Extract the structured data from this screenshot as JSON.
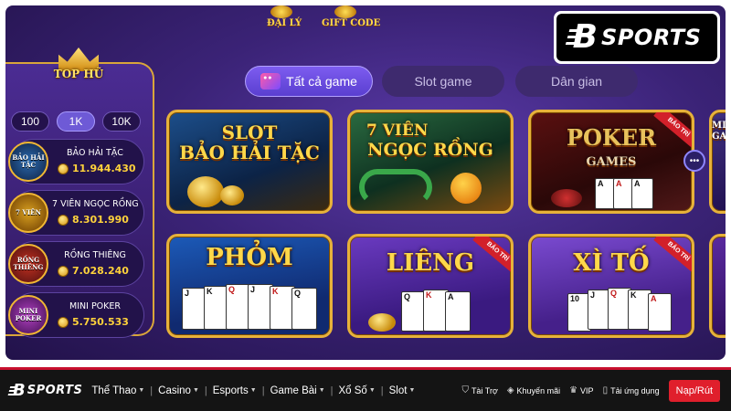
{
  "top_deco": {
    "agent_label": "ĐẠI LÝ",
    "giftcode_label": "GIFT CODE"
  },
  "brand": {
    "b": "B",
    "name": "SPORTS"
  },
  "tophu": {
    "title": "TOP HŨ",
    "tabs": [
      "100",
      "1K",
      "10K"
    ],
    "active_tab": "1K",
    "jackpots": [
      {
        "icon_text": "BẢO HẢI TẶC",
        "name": "BẢO HẢI TẶC",
        "amount": "11.944.430"
      },
      {
        "icon_text": "7 VIÊN",
        "name": "7 VIÊN NGỌC RỒNG",
        "amount": "8.301.990"
      },
      {
        "icon_text": "RỒNG THIÊNG",
        "name": "RỒNG THIÊNG",
        "amount": "7.028.240"
      },
      {
        "icon_text": "MINI POKER",
        "name": "MINI POKER",
        "amount": "5.750.533"
      }
    ]
  },
  "categories": [
    {
      "label": "Tất cả game",
      "active": true
    },
    {
      "label": "Slot game",
      "active": false
    },
    {
      "label": "Dân gian",
      "active": false
    }
  ],
  "games": {
    "bao_hai_tac": {
      "line1": "SLOT",
      "line2": "BẢO HẢI TẶC"
    },
    "ngoc_rong": {
      "line1": "7 VIÊN",
      "line2": "NGỌC RỒNG"
    },
    "poker": {
      "line1": "POKER",
      "line2": "GAMES",
      "badge": "BẢO TRÌ"
    },
    "partial_right": {
      "line1": "MINI",
      "line2": "GAM"
    },
    "phom": {
      "title": "PHỎM"
    },
    "lieng": {
      "title": "LIÊNG",
      "badge": "BẢO TRÌ"
    },
    "xi_to": {
      "title": "XÌ TỐ",
      "badge": "BẢO TRÌ"
    }
  },
  "cards": {
    "phom": [
      "J",
      "K",
      "Q",
      "J",
      "K",
      "Q"
    ],
    "lieng": [
      "Q",
      "K",
      "A"
    ],
    "xi_to": [
      "10",
      "J",
      "Q",
      "K",
      "A"
    ]
  },
  "more_button": "•••",
  "footer": {
    "nav": [
      "Thể Thao",
      "Casino",
      "Esports",
      "Game Bài",
      "Xổ Số",
      "Slot"
    ],
    "utils": [
      {
        "icon": "shield-icon",
        "glyph": "⛉",
        "label": "Tài Trợ"
      },
      {
        "icon": "tag-icon",
        "glyph": "◈",
        "label": "Khuyến mãi"
      },
      {
        "icon": "crown-icon",
        "glyph": "♛",
        "label": "VIP"
      },
      {
        "icon": "phone-icon",
        "glyph": "▯",
        "label": "Tải ứng dụng"
      }
    ],
    "cta": "Nạp/Rút"
  },
  "colors": {
    "accent_red": "#e01f2c",
    "gold": "#e7b23a",
    "purple_bg": "#3b2377"
  }
}
